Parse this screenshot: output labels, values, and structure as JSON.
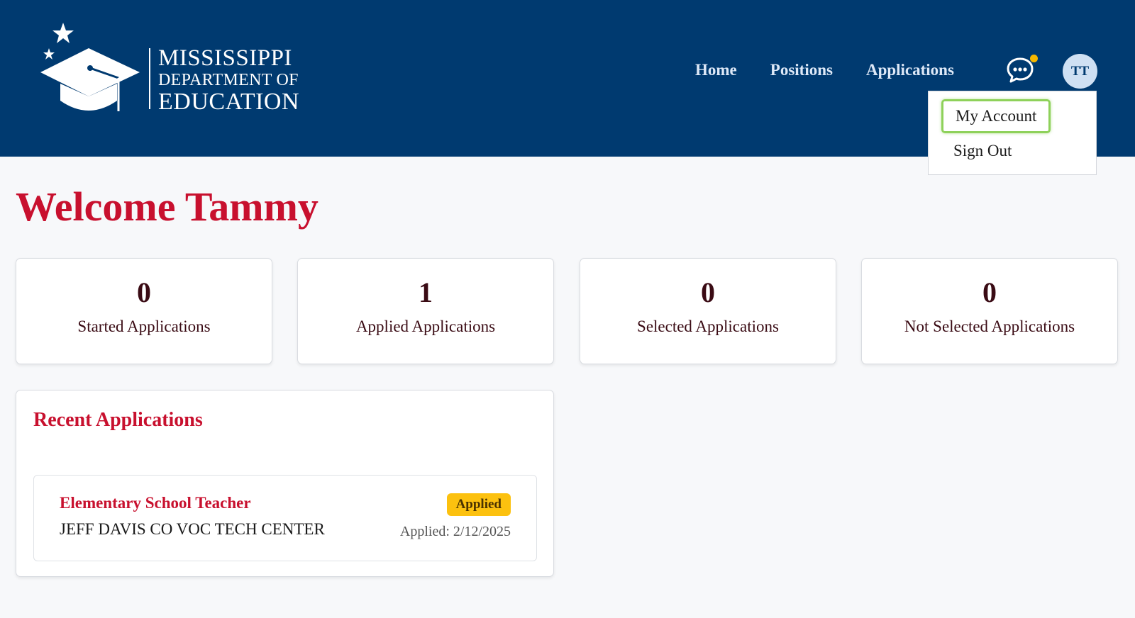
{
  "header": {
    "logo": {
      "line1": "MISSISSIPPI",
      "line2": "DEPARTMENT OF",
      "line3": "EDUCATION"
    },
    "nav": [
      {
        "label": "Home"
      },
      {
        "label": "Positions"
      },
      {
        "label": "Applications"
      }
    ],
    "chat_icon": "chat-bubble-icon",
    "avatar_initials": "TT"
  },
  "user_menu": {
    "items": [
      {
        "label": "My Account"
      },
      {
        "label": "Sign Out"
      }
    ]
  },
  "welcome": "Welcome Tammy",
  "stats": [
    {
      "count": "0",
      "label": "Started Applications"
    },
    {
      "count": "1",
      "label": "Applied Applications"
    },
    {
      "count": "0",
      "label": "Selected Applications"
    },
    {
      "count": "0",
      "label": "Not Selected Applications"
    }
  ],
  "recent": {
    "title": "Recent Applications",
    "items": [
      {
        "title": "Elementary School Teacher",
        "org": "JEFF DAVIS CO VOC TECH CENTER",
        "status": "Applied",
        "date": "Applied: 2/12/2025"
      }
    ]
  },
  "colors": {
    "header_bg": "#003a70",
    "accent_red": "#c8102e",
    "badge_yellow": "#fcc10f",
    "notif_dot": "#f6b800",
    "highlight_green": "#8ed15a"
  }
}
